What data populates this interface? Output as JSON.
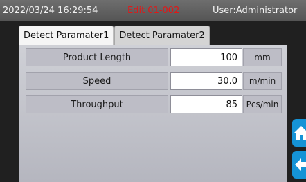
{
  "header": {
    "datetime": "2022/03/24 16:29:54",
    "edit_status": "Edit 01-002",
    "user": "User:Administrator",
    "edit_status_color": "#e01818"
  },
  "tabs": [
    {
      "label": "Detect Paramater1",
      "active": true
    },
    {
      "label": "Detect Paramater2",
      "active": false
    }
  ],
  "parameters": [
    {
      "label": "Product Length",
      "value": "100",
      "unit": "mm"
    },
    {
      "label": "Speed",
      "value": "30.0",
      "unit": "m/min"
    },
    {
      "label": "Throughput",
      "value": "85",
      "unit": "Pcs/min"
    }
  ],
  "side_buttons": [
    {
      "icon": "home-icon"
    },
    {
      "icon": "back-arrow-icon"
    }
  ],
  "colors": {
    "accent": "#1593d6",
    "header_bg": "#5f5f5f",
    "panel_bg": "#c4c5cc"
  }
}
